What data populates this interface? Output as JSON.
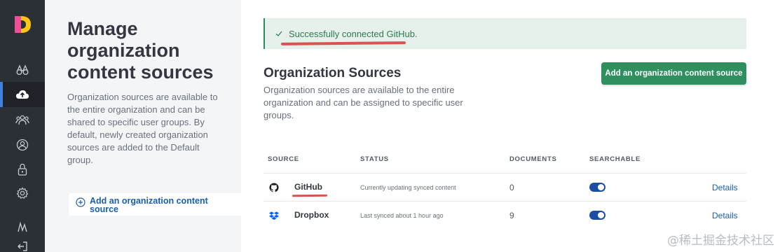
{
  "sidebar": {
    "items": [
      {
        "icon": "binoculars-icon",
        "active": false
      },
      {
        "icon": "cloud-upload-icon",
        "active": true
      },
      {
        "icon": "users-icon",
        "active": false
      },
      {
        "icon": "user-icon",
        "active": false
      },
      {
        "icon": "lock-icon",
        "active": false
      },
      {
        "icon": "gear-icon",
        "active": false
      },
      {
        "icon": "activity-icon",
        "active": false
      },
      {
        "icon": "logout-icon",
        "active": false
      }
    ]
  },
  "description_panel": {
    "title": "Manage organization content sources",
    "text": "Organization sources are available to the entire organization and can be shared to specific user groups. By default, newly created organization sources are added to the Default group.",
    "add_link": "Add an organization content source"
  },
  "toast": {
    "message": "Successfully connected GitHub."
  },
  "main": {
    "title": "Organization Sources",
    "description": "Organization sources are available to the entire organization and can be assigned to specific user groups.",
    "add_button": "Add an organization content source"
  },
  "table": {
    "headers": {
      "source": "SOURCE",
      "status": "STATUS",
      "documents": "DOCUMENTS",
      "searchable": "SEARCHABLE"
    },
    "rows": [
      {
        "icon": "github-icon",
        "source": "GitHub",
        "status": "Currently updating synced content",
        "documents": "0",
        "searchable": true,
        "action": "Details"
      },
      {
        "icon": "dropbox-icon",
        "source": "Dropbox",
        "status": "Last synced about 1 hour ago",
        "documents": "9",
        "searchable": true,
        "action": "Details"
      }
    ]
  },
  "watermark": "@稀土掘金技术社区",
  "colors": {
    "accent": "#1a5fb4",
    "success": "#2f8f5f",
    "rail": "#2b2f36",
    "toggle": "#1a4fa3",
    "annotation": "#d9534f"
  }
}
